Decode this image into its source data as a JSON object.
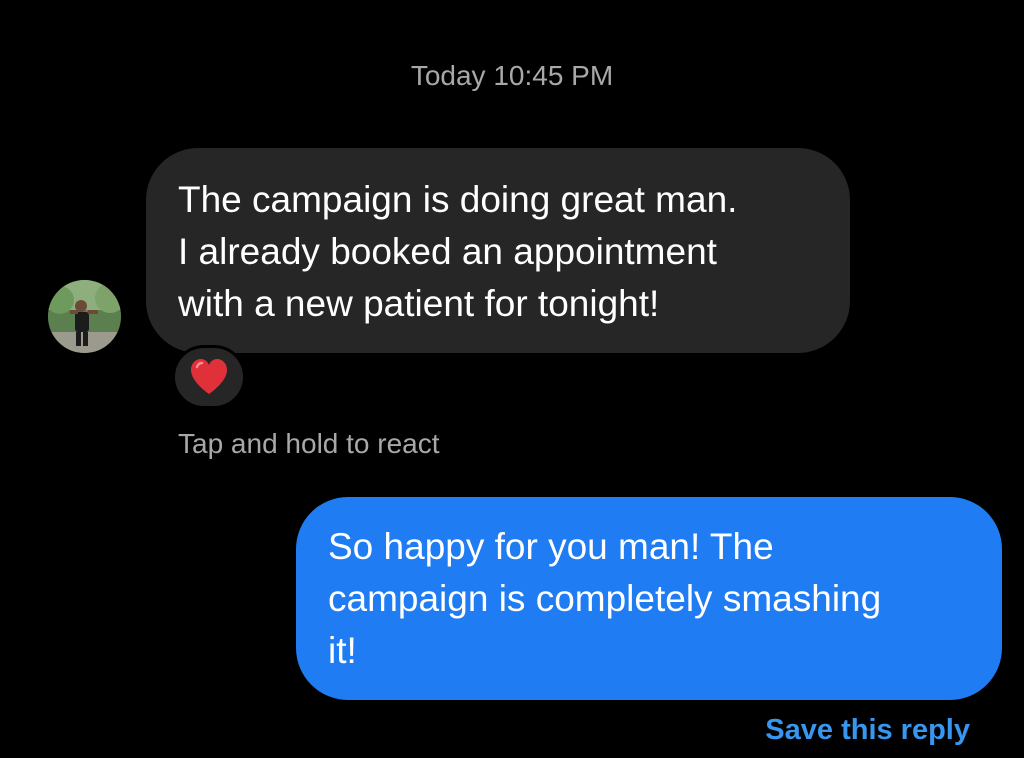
{
  "timestamp": "Today 10:45 PM",
  "incoming_message": {
    "lines": [
      "The campaign is doing great man.",
      "I already booked an appointment",
      "with a new patient for tonight!"
    ],
    "reaction": "❤️",
    "reaction_icon": "red-heart-emoji"
  },
  "hint_text": "Tap and hold to react",
  "outgoing_message": {
    "lines": [
      "So happy for you man! The",
      "campaign is completely smashing",
      "it!"
    ]
  },
  "save_reply_label": "Save this reply",
  "colors": {
    "background": "#000000",
    "incoming_bubble": "#262626",
    "outgoing_bubble": "#1f7cf2",
    "link": "#3797f0",
    "muted_text": "#a8a8a8"
  }
}
